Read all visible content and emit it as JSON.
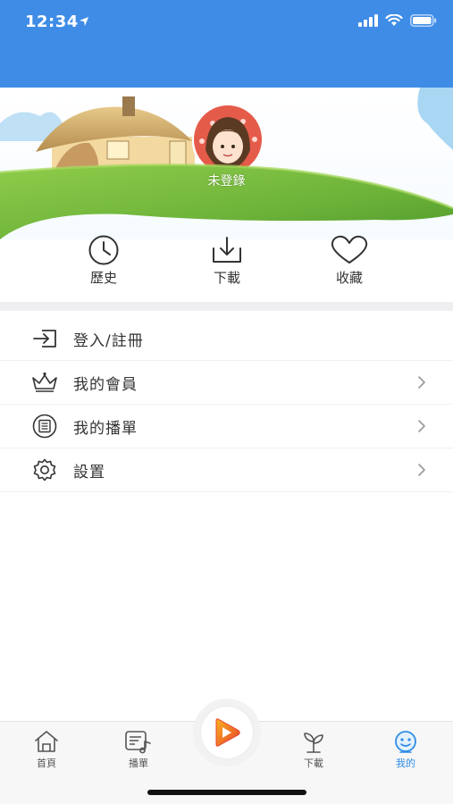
{
  "status_bar": {
    "time": "12:34"
  },
  "profile": {
    "username": "未登錄"
  },
  "quick_actions": [
    {
      "label": "歷史",
      "icon": "clock-icon"
    },
    {
      "label": "下載",
      "icon": "download-icon"
    },
    {
      "label": "收藏",
      "icon": "heart-icon"
    }
  ],
  "menu": [
    {
      "label": "登入/註冊",
      "icon": "login-icon",
      "has_arrow": false
    },
    {
      "label": "我的會員",
      "icon": "crown-icon",
      "has_arrow": true
    },
    {
      "label": "我的播單",
      "icon": "playlist-icon",
      "has_arrow": true
    },
    {
      "label": "設置",
      "icon": "gear-icon",
      "has_arrow": true
    }
  ],
  "tab_bar": {
    "tabs": [
      {
        "label": "首頁",
        "icon": "home-icon"
      },
      {
        "label": "播單",
        "icon": "playlist-note-icon"
      },
      {
        "label": "下載",
        "icon": "sprout-icon"
      },
      {
        "label": "我的",
        "icon": "smiley-icon"
      }
    ],
    "active": "我的"
  },
  "colors": {
    "header_blue": "#3f8ce6",
    "active_tab": "#2d8be6",
    "play_orange": "#f29a1b",
    "play_red": "#e8412c",
    "grass_green": "#7cbf3a"
  }
}
